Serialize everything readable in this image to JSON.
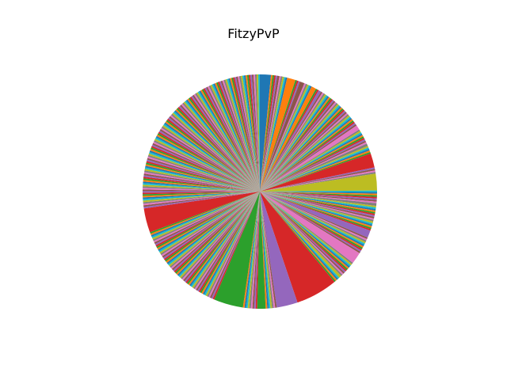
{
  "chart_data": {
    "type": "pie",
    "title": "FitzyPvP",
    "start_angle_deg": 90,
    "direction": "clockwise",
    "palette": [
      "#1f77b4",
      "#ff7f0e",
      "#2ca02c",
      "#d62728",
      "#9467bd",
      "#8c564b",
      "#e377c2",
      "#7f7f7f",
      "#bcbd22",
      "#17becf"
    ],
    "values": [
      2.1,
      0.3,
      0.3,
      0.3,
      0.3,
      0.4,
      0.3,
      0.3,
      0.3,
      0.3,
      0.3,
      1.6,
      0.3,
      0.3,
      0.3,
      0.9,
      0.3,
      0.3,
      0.3,
      0.3,
      0.3,
      0.9,
      0.3,
      0.3,
      0.5,
      0.3,
      0.3,
      0.3,
      0.3,
      0.3,
      0.3,
      0.3,
      0.3,
      0.3,
      0.3,
      0.3,
      0.3,
      0.3,
      0.3,
      0.3,
      0.3,
      0.3,
      0.3,
      0.3,
      0.3,
      0.3,
      0.3,
      0.3,
      0.3,
      0.3,
      0.3,
      0.3,
      0.3,
      0.3,
      0.3,
      0.3,
      0.9,
      0.3,
      0.3,
      0.3,
      0.3,
      0.3,
      0.3,
      0.3,
      0.3,
      0.3,
      0.3,
      0.5,
      0.3,
      0.3,
      0.3,
      0.3,
      0.3,
      2.7,
      0.3,
      0.3,
      0.3,
      0.3,
      3.2,
      0.3,
      0.3,
      0.3,
      0.3,
      0.3,
      0.3,
      0.3,
      0.3,
      0.5,
      0.3,
      0.3,
      0.3,
      0.3,
      0.3,
      0.3,
      0.3,
      0.3,
      0.3,
      0.3,
      0.3,
      0.3,
      0.3,
      0.3,
      0.3,
      0.3,
      1.4,
      0.3,
      0.3,
      0.3,
      0.3,
      0.3,
      0.3,
      0.3,
      0.3,
      0.3,
      0.3,
      0.3,
      2.2,
      0.3,
      0.3,
      0.3,
      0.3,
      0.3,
      0.3,
      0.3,
      0.3,
      0.3,
      0.3,
      0.3,
      0.5,
      0.3,
      0.3,
      0.3,
      0.3,
      8.0,
      4.0,
      0.3,
      0.3,
      0.3,
      0.3,
      0.3,
      0.3,
      0.3,
      1.6,
      0.3,
      0.3,
      0.3,
      0.3,
      0.3,
      0.3,
      0.3,
      0.3,
      0.3,
      5.6,
      0.3,
      0.3,
      0.3,
      0.3,
      0.3,
      0.3,
      0.3,
      0.3,
      0.3,
      0.3,
      0.3,
      0.3,
      0.3,
      0.3,
      0.3,
      0.3,
      0.3,
      0.3,
      0.3,
      0.3,
      0.3,
      0.3,
      0.3,
      0.3,
      0.3,
      0.3,
      0.3,
      0.3,
      0.3,
      0.3,
      0.3,
      0.3,
      0.3,
      0.3,
      0.3,
      0.3,
      0.3,
      0.3,
      0.3,
      0.3,
      0.3,
      0.3,
      0.3,
      0.3,
      0.3,
      0.3,
      0.3,
      0.3,
      0.3,
      0.3,
      0.3,
      0.3,
      0.3,
      0.3,
      0.3,
      0.3,
      0.3,
      0.3,
      0.3,
      0.3,
      4.6,
      0.3,
      0.3,
      0.3,
      0.3,
      0.3,
      0.3,
      0.3,
      0.3,
      0.3,
      0.3,
      0.3,
      0.3,
      0.3,
      0.3,
      0.3,
      0.3,
      0.3,
      0.3,
      0.3,
      0.3,
      0.3,
      0.3,
      0.3,
      0.3,
      0.3,
      0.3,
      0.3,
      0.3,
      0.3,
      0.3,
      0.3,
      0.3,
      0.3,
      0.3,
      0.3,
      0.3,
      0.3,
      0.3,
      0.3,
      0.3,
      0.3,
      0.3,
      0.3,
      0.3,
      0.3,
      0.3,
      0.3,
      0.3,
      0.3,
      0.3,
      0.3,
      0.3,
      0.3,
      0.3,
      0.3,
      0.3,
      0.3,
      0.3,
      0.3,
      0.3,
      0.3,
      0.3,
      0.3,
      0.3,
      0.3,
      0.3,
      0.3,
      0.3,
      0.3,
      0.3,
      0.3,
      0.3,
      0.3,
      0.3,
      0.3,
      0.3,
      0.3,
      0.3,
      0.3,
      0.3,
      0.3,
      0.3,
      0.3,
      0.3,
      0.3,
      0.3,
      0.3,
      0.3,
      0.3,
      0.3,
      0.3,
      0.3,
      0.3,
      0.3,
      0.3,
      0.3,
      0.3,
      0.3,
      0.3,
      0.3,
      0.3,
      0.3,
      0.3,
      0.3,
      0.3,
      0.3,
      0.3,
      0.3,
      0.3,
      0.3,
      0.3,
      0.3,
      0.3,
      0.3,
      0.3,
      0.3,
      0.3,
      0.3,
      0.3,
      0.3,
      0.3,
      0.3,
      0.3,
      0.3,
      0.3,
      0.3
    ]
  }
}
